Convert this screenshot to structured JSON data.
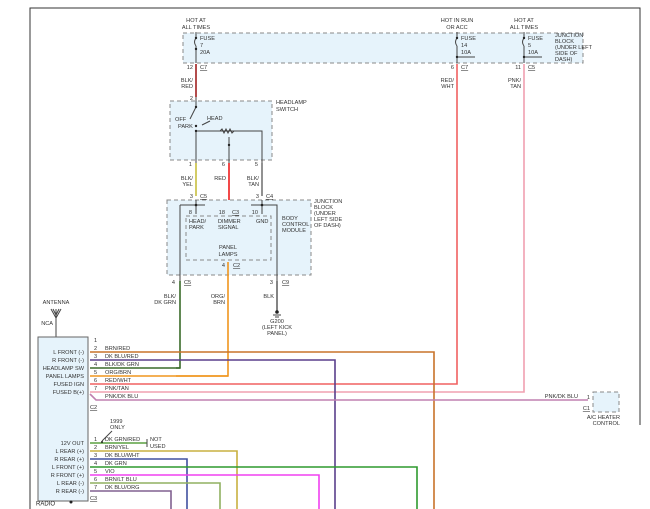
{
  "top_junction_block": {
    "label": [
      "JUNCTION",
      "BLOCK",
      "(UNDER LEFT",
      "SIDE OF",
      "DASH)"
    ],
    "fuses": [
      {
        "power": [
          "HOT AT",
          "ALL TIMES"
        ],
        "fuse": [
          "FUSE",
          "7",
          "20A"
        ],
        "pin": "12",
        "connector": "C7"
      },
      {
        "power": [
          "HOT IN RUN",
          "OR ACC"
        ],
        "fuse": [
          "FUSE",
          "14",
          "10A"
        ],
        "pin": "6",
        "connector": "C7"
      },
      {
        "power": [
          "HOT AT",
          "ALL TIMES"
        ],
        "fuse": [
          "FUSE",
          "5",
          "10A"
        ],
        "pin": "11",
        "connector": "C5"
      }
    ]
  },
  "wires_top": {
    "blk_red": [
      "BLK/",
      "RED"
    ],
    "red_wht": [
      "RED/",
      "WHT"
    ],
    "pnk_tan": [
      "PNK/",
      "TAN"
    ]
  },
  "headlamp_switch": {
    "label": [
      "HEADLAMP",
      "SWITCH"
    ],
    "in_pin": "2",
    "positions": {
      "off": "OFF",
      "park": "PARK",
      "head": "HEAD"
    },
    "pins": [
      "1",
      "6",
      "5"
    ],
    "wires": [
      [
        "BLK/",
        "YEL"
      ],
      [
        "RED"
      ],
      [
        "BLK/",
        "TAN"
      ]
    ]
  },
  "bcm": {
    "junction_label": [
      "JUNCTION",
      "BLOCK",
      "(UNDER",
      "LEFT SIDE",
      "OF DASH)"
    ],
    "module_label": [
      "BODY",
      "CONTROL",
      "MODULE"
    ],
    "in_connectors": [
      {
        "pin": "3",
        "conn": "C5"
      },
      {
        "pin": "3",
        "conn": "C4"
      }
    ],
    "inner_pins": [
      {
        "pin": "8",
        "label": [
          "HEAD/",
          "PARK"
        ]
      },
      {
        "pin": "18",
        "conn": "C3",
        "label": [
          "DIMMER",
          "SIGNAL"
        ]
      },
      {
        "pin": "10",
        "label": [
          "GND"
        ]
      }
    ],
    "panel_lamps": [
      "PANEL",
      "LAMPS"
    ],
    "out_connectors": [
      {
        "pin": "4",
        "conn": "C5"
      },
      {
        "pin": "4",
        "conn": "C2"
      },
      {
        "pin": "3",
        "conn": "C9"
      }
    ],
    "out_wires": [
      [
        "BLK/",
        "DK GRN"
      ],
      [
        "ORG/",
        "BRN"
      ],
      [
        "BLK"
      ]
    ],
    "ground": [
      "G200",
      "(LEFT KICK",
      "PANEL)"
    ]
  },
  "antenna": {
    "label": "ANTENNA",
    "nca": "NCA"
  },
  "radio": {
    "label": "RADIO",
    "c2": "C2",
    "c3": "C3",
    "c2_pins": [
      {
        "pin": "1",
        "func": "",
        "wire": ""
      },
      {
        "pin": "2",
        "func": "L FRONT (-)",
        "wire": "BRN/RED",
        "color": "#c8732a"
      },
      {
        "pin": "3",
        "func": "R FRONT (-)",
        "wire": "DK BLU/RED",
        "color": "#5a3f8c"
      },
      {
        "pin": "4",
        "func": "HEADLAMP SW",
        "wire": "BLK/DK GRN",
        "color": "#3a6b2a"
      },
      {
        "pin": "5",
        "func": "PANEL LAMPS",
        "wire": "ORG/BRN",
        "color": "#f0961e"
      },
      {
        "pin": "6",
        "func": "FUSED IGN",
        "wire": "RED/WHT",
        "color": "#f06060"
      },
      {
        "pin": "7",
        "func": "FUSED B(+)",
        "wire": "PNK/TAN",
        "color": "#f0a0b0"
      },
      {
        "pin": "",
        "func": "",
        "wire": "PNK/DK BLU",
        "color": "#c080b0"
      }
    ],
    "note_1999": [
      "1999",
      "ONLY"
    ],
    "not_used": [
      "NOT",
      "USED"
    ],
    "c3_pins": [
      {
        "pin": "1",
        "func": "12V OUT",
        "wire": "DK GRN/RED",
        "color": "#5aa040"
      },
      {
        "pin": "2",
        "func": "L REAR (+)",
        "wire": "BRN/YEL",
        "color": "#c8b040"
      },
      {
        "pin": "3",
        "func": "R REAR (+)",
        "wire": "DK BLU/WHT",
        "color": "#4050a0"
      },
      {
        "pin": "4",
        "func": "L FRONT (+)",
        "wire": "DK GRN",
        "color": "#2e9a2e"
      },
      {
        "pin": "5",
        "func": "R FRONT (+)",
        "wire": "VIO",
        "color": "#f040f0"
      },
      {
        "pin": "6",
        "func": "L REAR (-)",
        "wire": "BRN/LT BLU",
        "color": "#90b060"
      },
      {
        "pin": "7",
        "func": "R REAR (-)",
        "wire": "DK BLU/ORG",
        "color": "#806090"
      }
    ]
  },
  "ac_heater": {
    "label": [
      "A/C HEATER",
      "CONTROL"
    ],
    "pin": "1",
    "conn": "C1",
    "wire": "PNK/DK BLU"
  }
}
